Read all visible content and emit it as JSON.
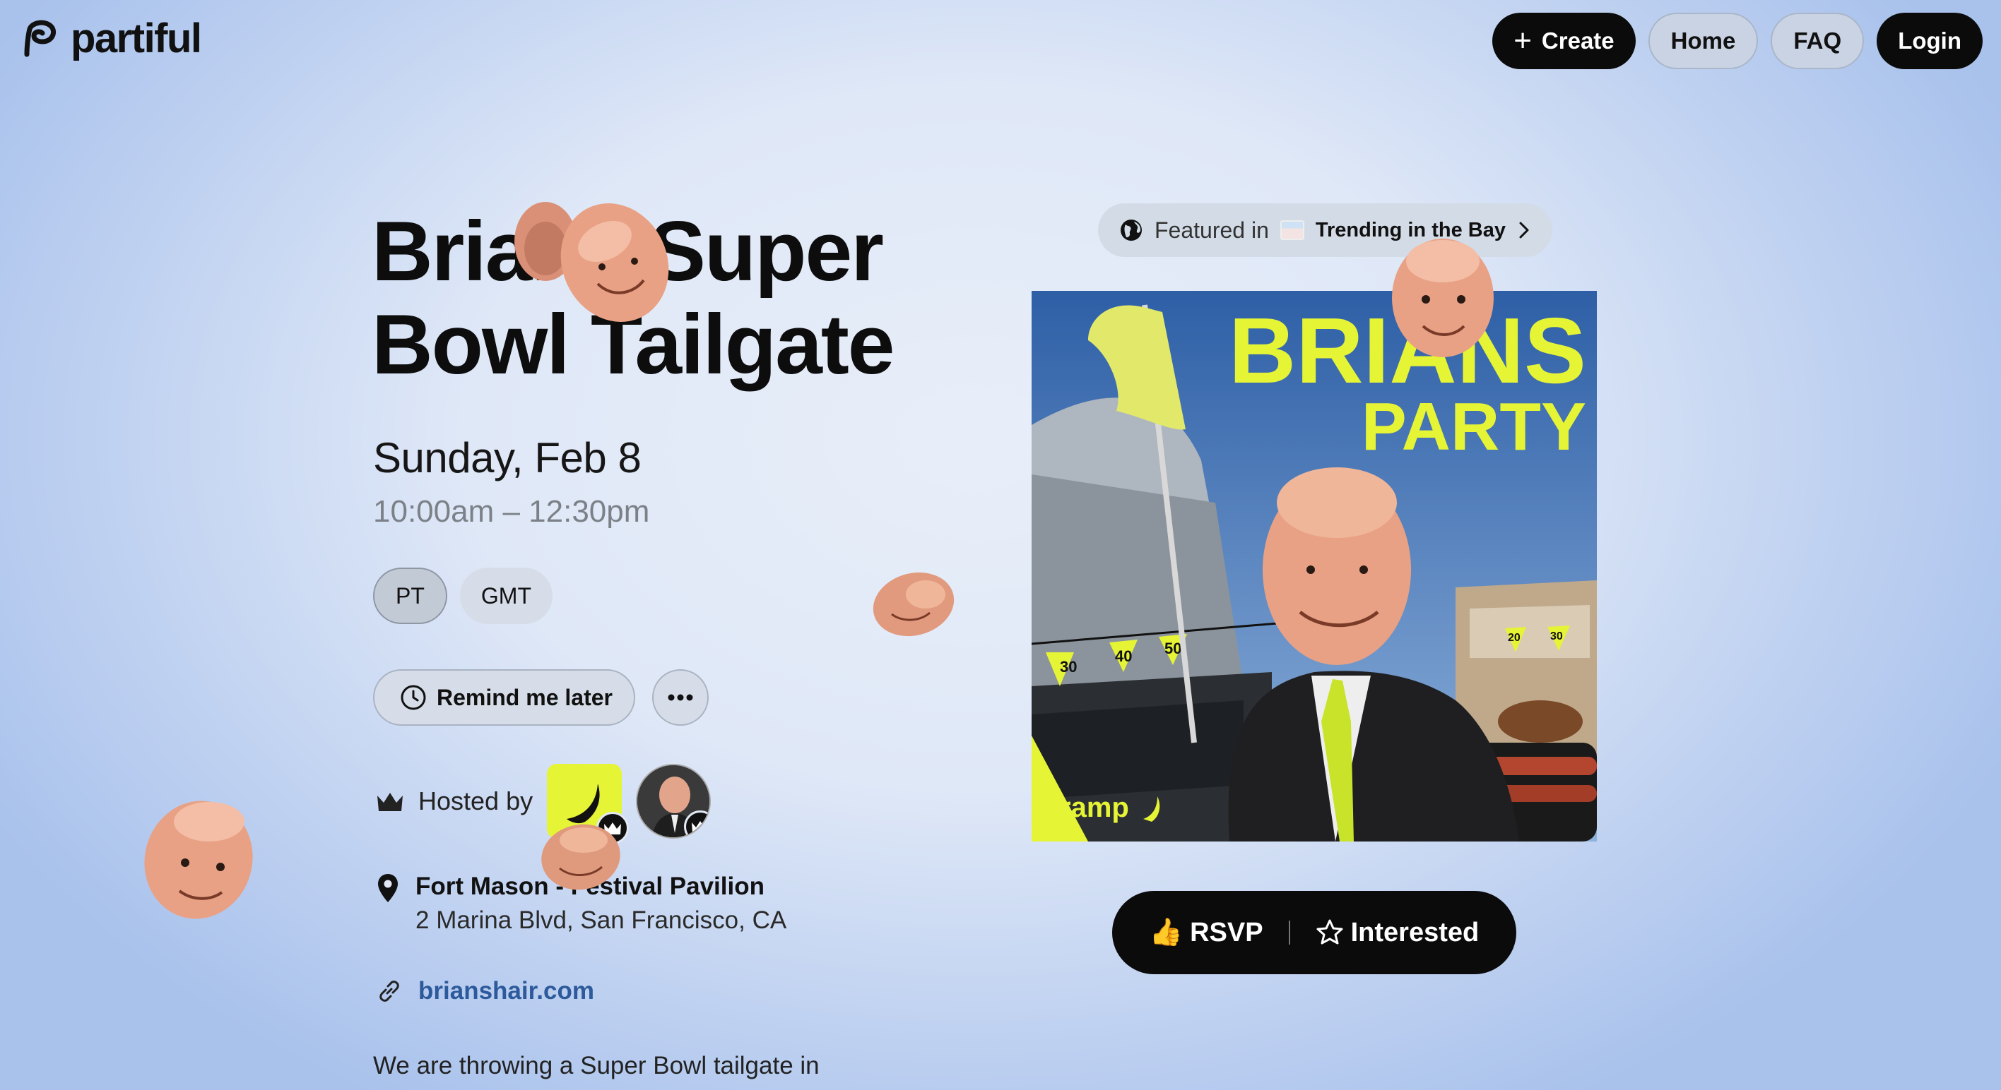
{
  "brand": {
    "name": "partiful",
    "icon": "partiful-p-logo"
  },
  "nav": {
    "create": "Create",
    "home": "Home",
    "faq": "FAQ",
    "login": "Login"
  },
  "event": {
    "title_line1": "Brians Super",
    "title_line2": "Bowl Tailgate",
    "date": "Sunday, Feb 8",
    "time": "10:00am – 12:30pm",
    "timezones": [
      {
        "label": "PT",
        "selected": true
      },
      {
        "label": "GMT",
        "selected": false
      }
    ],
    "remind_label": "Remind me later",
    "hosted_by_label": "Hosted by",
    "hosts": [
      "ramp",
      "brian"
    ],
    "location_name": "Fort Mason - Festival Pavilion",
    "location_address": "2 Marina Blvd, San Francisco, CA",
    "website": "brianshair.com",
    "description_start": "We are throwing a Super Bowl tailgate in"
  },
  "featured": {
    "prefix": "Featured in",
    "name": "Trending in the Bay"
  },
  "poster": {
    "headline1": "BRIANS",
    "headline2": "PARTY",
    "brand": "ramp",
    "pennants": [
      "30",
      "40",
      "50",
      "20",
      "30"
    ]
  },
  "actions": {
    "rsvp": "RSVP",
    "interested": "Interested",
    "rsvp_emoji": "👍"
  },
  "colors": {
    "accent_yellow": "#e6f436",
    "link": "#2c5a9a",
    "dark": "#0b0b0b"
  }
}
